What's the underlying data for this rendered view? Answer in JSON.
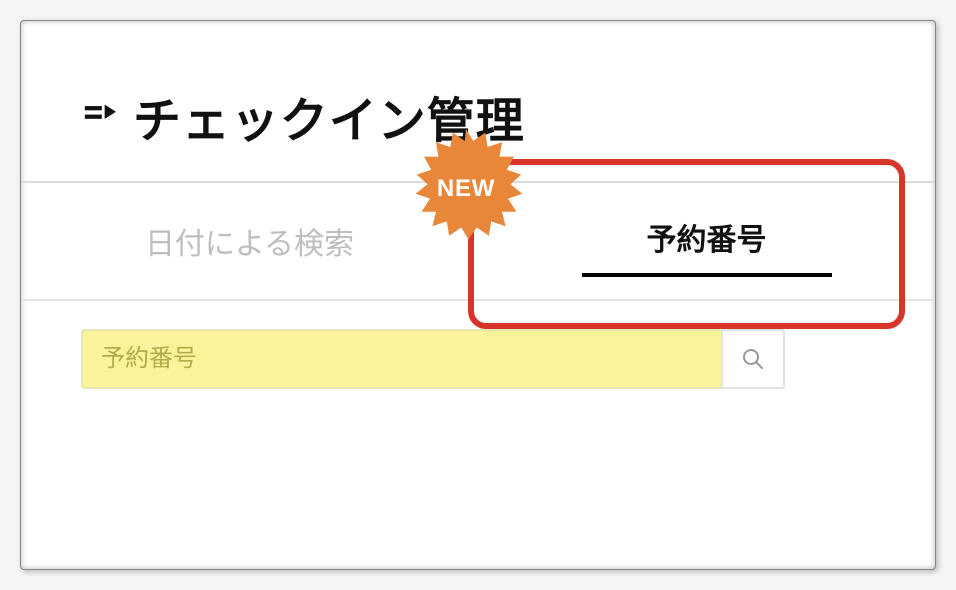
{
  "header": {
    "title": "チェックイン管理"
  },
  "tabs": {
    "inactive_label": "日付による検索",
    "active_label": "予約番号"
  },
  "badge": {
    "label": "NEW"
  },
  "search": {
    "placeholder": "予約番号"
  }
}
